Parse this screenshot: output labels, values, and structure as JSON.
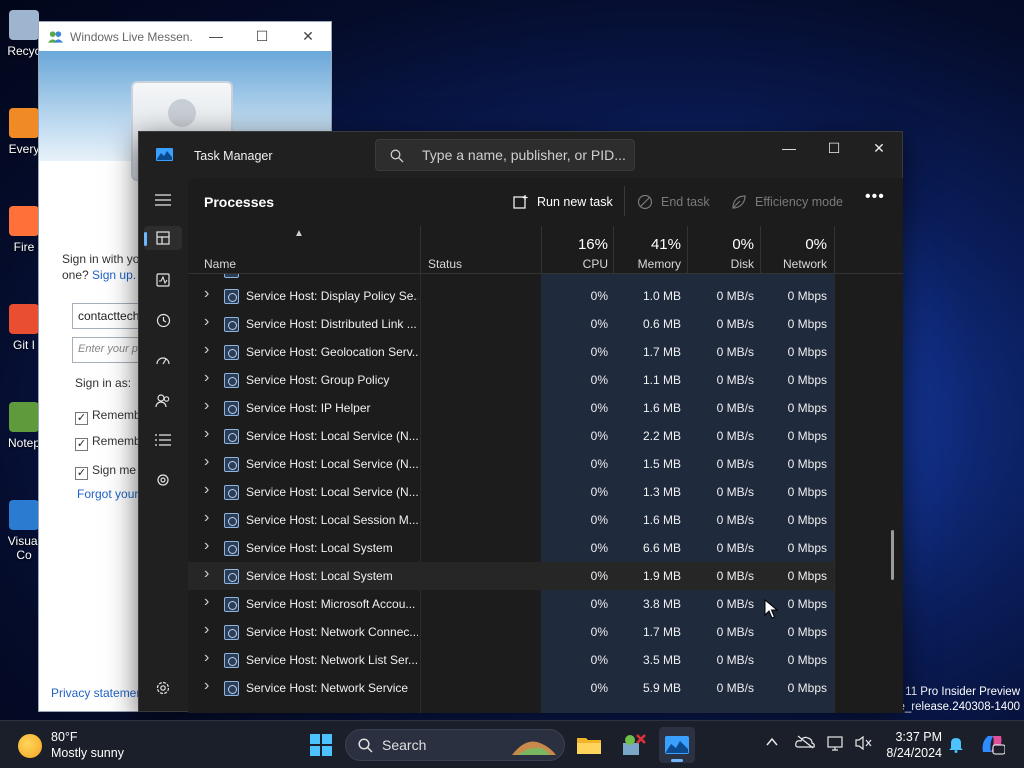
{
  "desktop": {
    "icons": [
      {
        "label": "Recyc",
        "color": "#9fb4cf"
      },
      {
        "label": "Every",
        "color": "#f08a24"
      },
      {
        "label": "Fire",
        "color": "#ff7139"
      },
      {
        "label": "Git I",
        "color": "#e94e31"
      },
      {
        "label": "Notep",
        "color": "#5f9b3c"
      },
      {
        "label": "Visual\nCo",
        "color": "#2b7bd1"
      }
    ],
    "watermark_line1": "11 Pro Insider Preview",
    "watermark_line2": "ge_release.240308-1400"
  },
  "messenger": {
    "title": "Windows Live Messen...",
    "controls": {
      "minimize": "—",
      "maximize": "☐",
      "close": "✕"
    },
    "signin_text": "Sign in with yo",
    "signin_text2": "one?",
    "signup_link": "Sign up.",
    "email_value": "contacttech",
    "password_placeholder": "Enter your p",
    "sign_in_as": "Sign in as:",
    "remember1": "Rememb",
    "remember2": "Rememb",
    "signme": "Sign me",
    "forgot": "Forgot your",
    "privacy": "Privacy statemen"
  },
  "taskmanager": {
    "title": "Task Manager",
    "search_placeholder": "Type a name, publisher, or PID...",
    "window_controls": {
      "minimize": "—",
      "maximize": "☐",
      "close": "✕"
    },
    "nav_icons": [
      "hamburger-icon",
      "processes-icon",
      "performance-icon",
      "app-history-icon",
      "startup-apps-icon",
      "users-icon",
      "details-icon",
      "services-icon",
      "settings-icon"
    ],
    "page_title": "Processes",
    "run_new_task": "Run new task",
    "end_task": "End task",
    "efficiency_mode": "Efficiency mode",
    "more": "•••",
    "columns": {
      "name": "Name",
      "status": "Status",
      "cpu_pct": "16%",
      "cpu": "CPU",
      "memory_pct": "41%",
      "memory": "Memory",
      "disk_pct": "0%",
      "disk": "Disk",
      "network_pct": "0%",
      "network": "Network"
    },
    "processes": [
      {
        "name": "Service Host: Display Policy Se...",
        "cpu": "0%",
        "memory": "1.0 MB",
        "disk": "0 MB/s",
        "network": "0 Mbps"
      },
      {
        "name": "Service Host: Distributed Link ...",
        "cpu": "0%",
        "memory": "0.6 MB",
        "disk": "0 MB/s",
        "network": "0 Mbps"
      },
      {
        "name": "Service Host: Geolocation Serv...",
        "cpu": "0%",
        "memory": "1.7 MB",
        "disk": "0 MB/s",
        "network": "0 Mbps"
      },
      {
        "name": "Service Host: Group Policy",
        "cpu": "0%",
        "memory": "1.1 MB",
        "disk": "0 MB/s",
        "network": "0 Mbps"
      },
      {
        "name": "Service Host: IP Helper",
        "cpu": "0%",
        "memory": "1.6 MB",
        "disk": "0 MB/s",
        "network": "0 Mbps"
      },
      {
        "name": "Service Host: Local Service (N...",
        "cpu": "0%",
        "memory": "2.2 MB",
        "disk": "0 MB/s",
        "network": "0 Mbps"
      },
      {
        "name": "Service Host: Local Service (N...",
        "cpu": "0%",
        "memory": "1.5 MB",
        "disk": "0 MB/s",
        "network": "0 Mbps"
      },
      {
        "name": "Service Host: Local Service (N...",
        "cpu": "0%",
        "memory": "1.3 MB",
        "disk": "0 MB/s",
        "network": "0 Mbps"
      },
      {
        "name": "Service Host: Local Session M...",
        "cpu": "0%",
        "memory": "1.6 MB",
        "disk": "0 MB/s",
        "network": "0 Mbps"
      },
      {
        "name": "Service Host: Local System",
        "cpu": "0%",
        "memory": "6.6 MB",
        "disk": "0 MB/s",
        "network": "0 Mbps"
      },
      {
        "name": "Service Host: Local System",
        "cpu": "0%",
        "memory": "1.9 MB",
        "disk": "0 MB/s",
        "network": "0 Mbps"
      },
      {
        "name": "Service Host: Microsoft Accou...",
        "cpu": "0%",
        "memory": "3.8 MB",
        "disk": "0 MB/s",
        "network": "0 Mbps"
      },
      {
        "name": "Service Host: Network Connec...",
        "cpu": "0%",
        "memory": "1.7 MB",
        "disk": "0 MB/s",
        "network": "0 Mbps"
      },
      {
        "name": "Service Host: Network List Ser...",
        "cpu": "0%",
        "memory": "3.5 MB",
        "disk": "0 MB/s",
        "network": "0 Mbps"
      },
      {
        "name": "Service Host: Network Service",
        "cpu": "0%",
        "memory": "5.9 MB",
        "disk": "0 MB/s",
        "network": "0 Mbps"
      }
    ]
  },
  "taskbar": {
    "weather_temp": "80°F",
    "weather_desc": "Mostly sunny",
    "search_label": "Search",
    "time": "3:37 PM",
    "date": "8/24/2024",
    "apps": [
      "start-icon",
      "search-icon",
      "file-explorer-icon",
      "app-icon",
      "task-manager-icon"
    ],
    "tray": [
      "chevron-up-icon",
      "onedrive-icon",
      "display-icon",
      "volume-muted-icon",
      "notification-bell-icon",
      "copilot-icon"
    ]
  }
}
